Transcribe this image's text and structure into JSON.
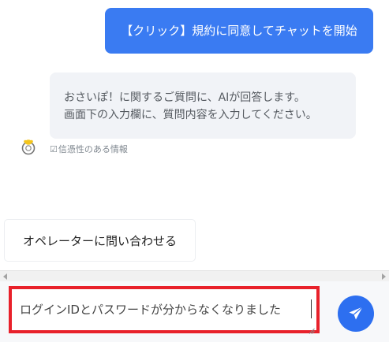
{
  "chat": {
    "user_message": "【クリック】規約に同意してチャットを開始",
    "bot_message_line1": "おさいぽ！に関するご質問に、AIが回答します。",
    "bot_message_line2": "画面下の入力欄に、質問内容を入力してください。",
    "trust_note": "信憑性のある情報",
    "trust_icon": "checkbox-icon",
    "avatar_icon": "bot-avatar-icon"
  },
  "actions": {
    "operator_label": "オペレーターに問い合わせる"
  },
  "input": {
    "value": "ログインIDとパスワードが分からなくなりました",
    "send_icon": "paper-plane-icon"
  },
  "colors": {
    "user_bubble": "#3a7bf2",
    "bot_bubble": "#f1f3f7",
    "highlight_border": "#e8212b",
    "send_button": "#2d6ff0"
  }
}
